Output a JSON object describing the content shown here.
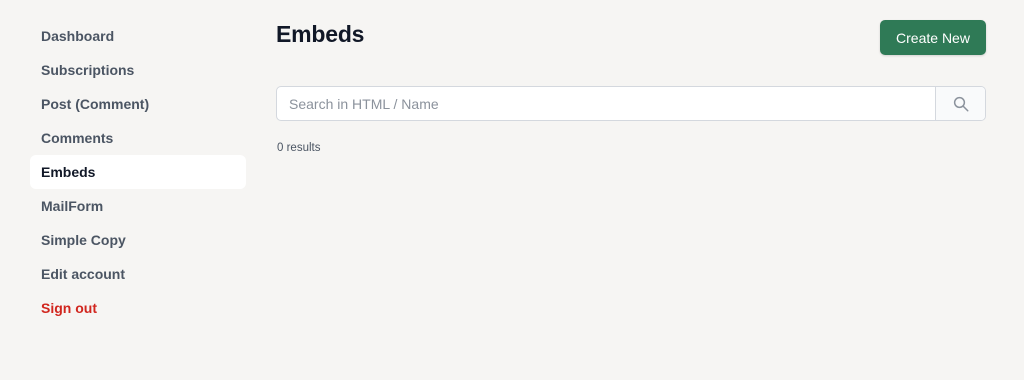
{
  "sidebar": {
    "items": [
      {
        "label": "Dashboard"
      },
      {
        "label": "Subscriptions"
      },
      {
        "label": "Post (Comment)"
      },
      {
        "label": "Comments"
      },
      {
        "label": "Embeds",
        "active": true
      },
      {
        "label": "MailForm"
      },
      {
        "label": "Simple Copy"
      },
      {
        "label": "Edit account"
      },
      {
        "label": "Sign out",
        "color": "#d1261e"
      }
    ]
  },
  "header": {
    "title": "Embeds",
    "create_label": "Create New",
    "accent": "#2f7a56"
  },
  "search": {
    "placeholder": "Search in HTML / Name",
    "value": "",
    "icon": "search-icon"
  },
  "results": {
    "text": "0 results"
  }
}
